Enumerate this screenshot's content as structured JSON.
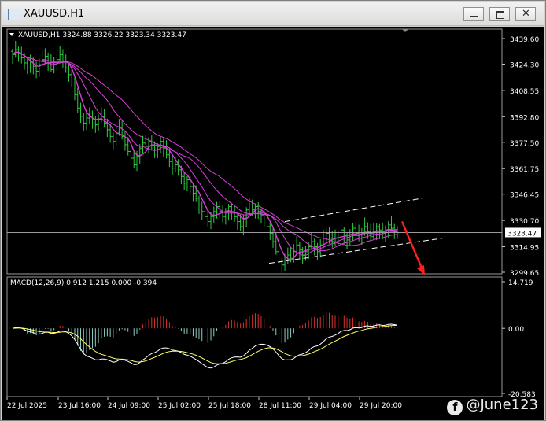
{
  "window": {
    "title": "XAUUSD,H1",
    "buttons": [
      "minimize",
      "restore",
      "close"
    ]
  },
  "watermark": {
    "text": "@June123",
    "icon": "facebook-icon"
  },
  "colors": {
    "background": "#000000",
    "candles": "#2ecc40",
    "ma": "#d63fd6",
    "macd_signal": "#ffff66",
    "macd_main": "#ffffff",
    "hist_positive": "#e03030",
    "hist_negative": "#8fd0c8",
    "channel": "#ffffff",
    "arrow": "#ff2020",
    "axis_text": "#ffffff",
    "price_label_bg": "#ffffff"
  },
  "chart_data": [
    {
      "type": "candlestick",
      "title": "XAUUSD,H1",
      "ohlc_header": "XAUUSD,H1  3324.88 3326.22 3323.34 3323.47",
      "current_price": "3323.47",
      "y_ticks": [
        "3439.60",
        "3424.30",
        "3408.55",
        "3392.80",
        "3377.50",
        "3361.75",
        "3346.45",
        "3330.70",
        "3314.95",
        "3299.65"
      ],
      "ylim": [
        3299.65,
        3439.6
      ],
      "x_ticks": [
        "22 Jul 2025",
        "23 Jul 16:00",
        "24 Jul 09:00",
        "25 Jul 02:00",
        "25 Jul 18:00",
        "28 Jul 11:00",
        "29 Jul 04:00",
        "29 Jul 20:00"
      ],
      "close_series": [
        3430,
        3433,
        3431,
        3428,
        3425,
        3422,
        3426,
        3423,
        3420,
        3424,
        3427,
        3429,
        3425,
        3421,
        3424,
        3427,
        3430,
        3426,
        3422,
        3418,
        3413,
        3406,
        3398,
        3393,
        3389,
        3392,
        3395,
        3391,
        3388,
        3391,
        3393,
        3389,
        3385,
        3381,
        3378,
        3383,
        3386,
        3381,
        3376,
        3372,
        3368,
        3364,
        3369,
        3374,
        3377,
        3375,
        3378,
        3376,
        3373,
        3375,
        3378,
        3374,
        3370,
        3366,
        3362,
        3364,
        3361,
        3357,
        3353,
        3355,
        3351,
        3347,
        3344,
        3340,
        3336,
        3333,
        3330,
        3333,
        3336,
        3339,
        3336,
        3333,
        3336,
        3339,
        3336,
        3333,
        3330,
        3327,
        3332,
        3337,
        3340,
        3337,
        3339,
        3336,
        3334,
        3331,
        3327,
        3323,
        3318,
        3312,
        3306,
        3304,
        3307,
        3310,
        3308,
        3312,
        3316,
        3313,
        3310,
        3312,
        3315,
        3318,
        3315,
        3312,
        3316,
        3320,
        3323,
        3320,
        3317,
        3320,
        3322,
        3325,
        3322,
        3319,
        3322,
        3326,
        3323,
        3320,
        3323,
        3327,
        3324,
        3321,
        3324,
        3327,
        3325,
        3322,
        3325,
        3328,
        3326,
        3324,
        3323.47
      ],
      "moving_averages": 4,
      "channel": {
        "upper_from": 3330,
        "upper_to": 3344,
        "lower_from": 3305,
        "lower_to": 3320
      },
      "arrow_target": 3299.65
    },
    {
      "type": "bar",
      "title": "MACD(12,26,9)",
      "header": "MACD(12,26,9) 0.912 1.215 0.000 -0.394",
      "y_ticks": [
        "14.719",
        "0.00",
        "-20.583"
      ],
      "ylim": [
        -20.583,
        14.719
      ],
      "series": [
        {
          "name": "histogram"
        },
        {
          "name": "main"
        },
        {
          "name": "signal"
        }
      ]
    }
  ]
}
